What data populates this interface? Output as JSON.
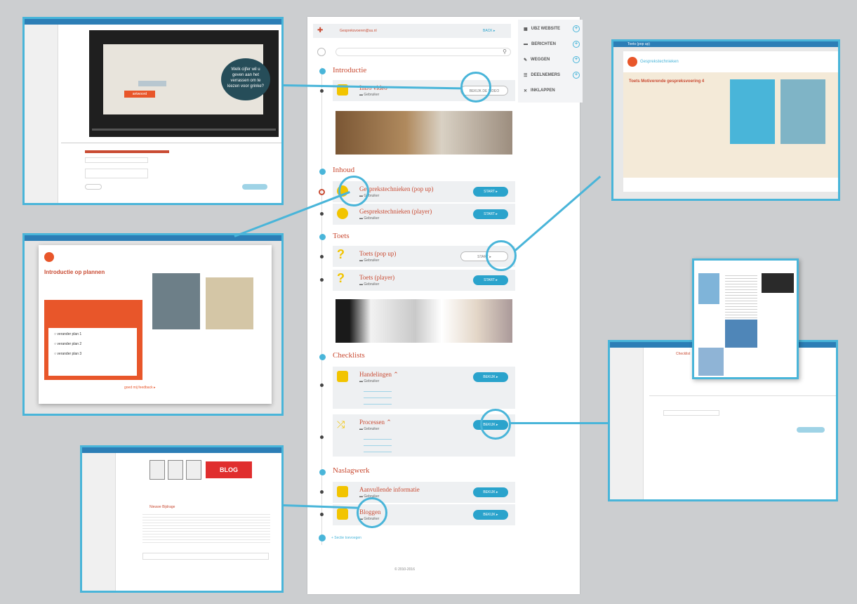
{
  "center_page": {
    "topbar_text": "Gespreksvoeren@uu.nl",
    "topbar_right": "BACK ▸",
    "side_menu": [
      "UBZ WEBSITE",
      "BERICHTEN",
      "WEGGEN",
      "DEELNEMERS",
      "INKLAPPEN"
    ],
    "sections": [
      {
        "title": "Introductie",
        "items": [
          {
            "title": "Intro video",
            "button": "BEKIJK DE VIDEO"
          }
        ]
      },
      {
        "title": "Inhoud",
        "items": [
          {
            "title": "Gespreks­technieken (pop up)",
            "button": "START ▸"
          },
          {
            "title": "Gesprekstechnieken (player)",
            "button": "START ▸"
          }
        ]
      },
      {
        "title": "Toets",
        "items": [
          {
            "title": "Toets (pop up)",
            "button": "START ▸"
          },
          {
            "title": "Toets (player)",
            "button": "START ▸"
          }
        ]
      },
      {
        "title": "Checklists",
        "items": [
          {
            "title": "Handelingen ⌃",
            "button": "BEKIJK ▸"
          },
          {
            "title": "Processen ⌃",
            "button": "BEKIJK ▸"
          }
        ]
      },
      {
        "title": "Naslagwerk",
        "items": [
          {
            "title": "Aanvullende informatie",
            "button": "BEKIJK ▸"
          },
          {
            "title": "Bloggen",
            "button": "BEKIJK ▸"
          }
        ]
      }
    ],
    "sub_label": "Gebruiker",
    "add_section": "+ Sectie toevoegen",
    "footer": "© 2010-2016 "
  },
  "popups": {
    "video_bubble": "Welk cijfer wil u geven aan het verrassen om te kiezen voor grinke?",
    "video_btn1": "",
    "video_btn2": "antwoord",
    "toets_title": "Toets (pop up)",
    "toets_brand": "Gesprekstechnieken",
    "toets_heading": "Toets Motiverende gespreksvoering 4",
    "intro_title": "Introductie op plannen",
    "intro_options": [
      "verander plan 1",
      "verander plan 2",
      "verander plan 3"
    ],
    "intro_footer": "goed mij feedback ▸",
    "blog_label": "BLOG",
    "blog_section": "Nieuwe Bijdrage",
    "checklist_section": "Checklist"
  },
  "colors": {
    "accent": "#49b5d9",
    "red": "#c94b33",
    "yellow": "#f2c400",
    "orange": "#e8562a"
  }
}
